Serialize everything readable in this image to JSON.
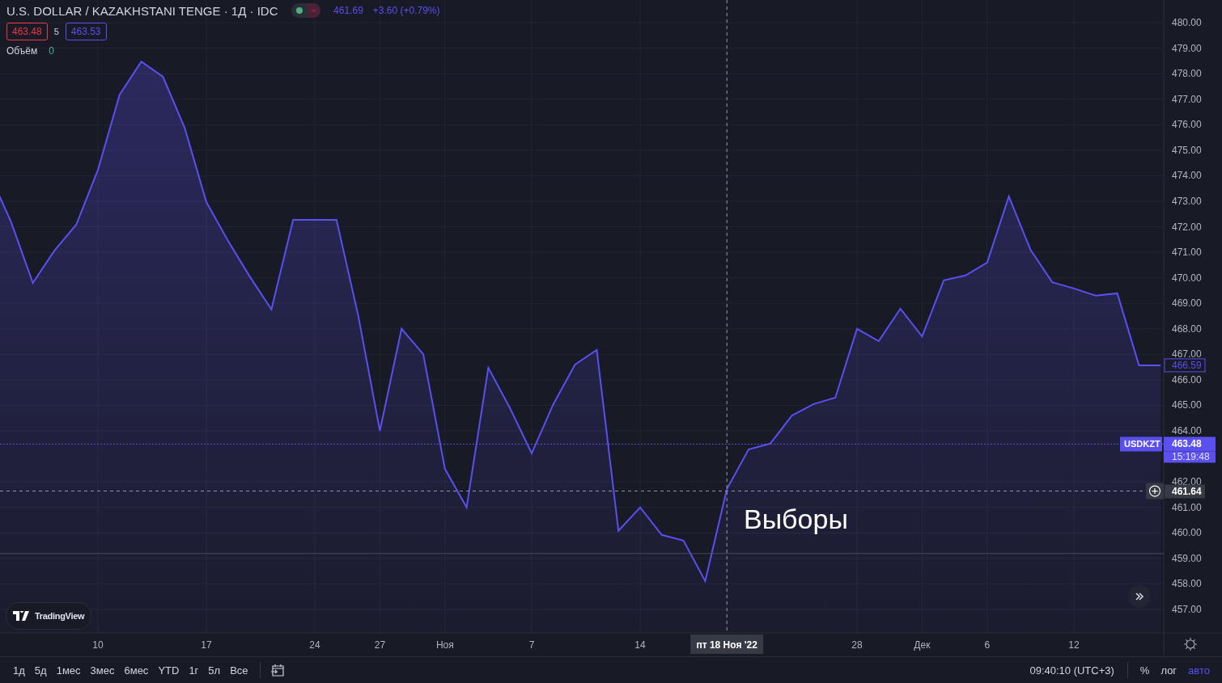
{
  "last_value": "466.59",
  "header": {
    "title": "U.S. DOLLAR / KAZAKHSTANI TENGE · 1Д · IDC",
    "status_symbol": "≈",
    "last": "461.69",
    "change": "+3.60 (+0.79%)"
  },
  "quote": {
    "bid": "463.48",
    "spread": "5",
    "ask": "463.53"
  },
  "volume": {
    "label": "Объём",
    "value": "0"
  },
  "chart": {
    "chart_data": {
      "type": "area",
      "grid": true,
      "categories": [
        null,
        null,
        null,
        null,
        null,
        "10",
        null,
        null,
        null,
        null,
        "17",
        null,
        null,
        null,
        null,
        "24",
        null,
        null,
        "27",
        null,
        null,
        "Ноя",
        null,
        null,
        null,
        "7",
        null,
        null,
        null,
        null,
        "14",
        null,
        null,
        null,
        "пт 18 Ноя '22",
        null,
        null,
        null,
        null,
        null,
        "28",
        null,
        null,
        "Дек",
        null,
        null,
        "6",
        null,
        null,
        null,
        "12",
        null,
        null,
        null,
        null
      ],
      "series": [
        {
          "name": "USDKZT",
          "color": "#5b4ff0",
          "values": [
            474.08,
            472.18,
            469.8,
            471.07,
            472.08,
            474.23,
            477.18,
            478.48,
            477.88,
            475.88,
            472.97,
            471.45,
            470.05,
            468.76,
            472.27,
            472.27,
            472.27,
            468.53,
            464.0,
            468.0,
            467.01,
            462.51,
            461.0,
            466.47,
            464.89,
            463.12,
            465.05,
            466.6,
            467.17,
            460.08,
            461.0,
            459.92,
            459.7,
            458.11,
            461.72,
            463.27,
            463.5,
            464.6,
            465.05,
            465.3,
            468.0,
            467.52,
            468.79,
            467.7,
            469.9,
            470.09,
            470.6,
            473.19,
            471.1,
            469.83,
            469.58,
            469.3,
            469.39,
            466.57,
            466.57
          ]
        }
      ],
      "ylim": [
        456.08,
        480.89
      ],
      "yticks": [
        {
          "value": 457,
          "label": "457.00"
        },
        {
          "value": 458,
          "label": "458.00"
        },
        {
          "value": 459,
          "label": "459.00"
        },
        {
          "value": 460,
          "label": "460.00"
        },
        {
          "value": 461,
          "label": "461.00"
        },
        {
          "value": 462,
          "label": "462.00"
        },
        {
          "value": 464,
          "label": "464.00"
        },
        {
          "value": 465,
          "label": "465.00"
        },
        {
          "value": 466,
          "label": "466.00"
        },
        {
          "value": 467,
          "label": "467.00"
        },
        {
          "value": 468,
          "label": "468.00"
        },
        {
          "value": 469,
          "label": "469.00"
        },
        {
          "value": 470,
          "label": "470.00"
        },
        {
          "value": 471,
          "label": "471.00"
        },
        {
          "value": 472,
          "label": "472.00"
        },
        {
          "value": 473,
          "label": "473.00"
        },
        {
          "value": 474,
          "label": "474.00"
        },
        {
          "value": 475,
          "label": "475.00"
        },
        {
          "value": 476,
          "label": "476.00"
        },
        {
          "value": 477,
          "label": "477.00"
        },
        {
          "value": 478,
          "label": "478.00"
        },
        {
          "value": 479,
          "label": "479.00"
        },
        {
          "value": 480,
          "label": "480.00"
        }
      ],
      "ref_lines": [
        {
          "axis": "y",
          "value": 463.48,
          "label": "463.48"
        },
        {
          "axis": "y",
          "value": 461.64,
          "label": "461.64"
        },
        {
          "axis": "y",
          "value": 459.19
        },
        {
          "axis": "x",
          "value": "пт 18 Ноя '22"
        }
      ],
      "annotations": [
        "Выборы"
      ]
    },
    "countdown": "15:19:48"
  },
  "logo": "TradingView",
  "ranges": [
    "1д",
    "5д",
    "1мес",
    "3мес",
    "6мес",
    "YTD",
    "1г",
    "5л",
    "Все"
  ],
  "time": "09:40:10 (UTC+3)",
  "scale_buttons": [
    {
      "label": "%",
      "selected": false
    },
    {
      "label": "лог",
      "selected": false
    },
    {
      "label": "авто",
      "selected": true
    }
  ]
}
